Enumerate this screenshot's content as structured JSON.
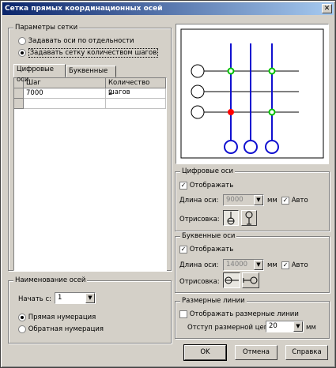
{
  "window": {
    "title": "Сетка прямых координационных осей",
    "close_glyph": "✕"
  },
  "grid_params": {
    "title": "Параметры сетки",
    "options": [
      {
        "label": "Задавать оси по отдельности",
        "selected": false
      },
      {
        "label": "Задавать сетку количеством шагов",
        "selected": true
      }
    ],
    "tabs": [
      {
        "label": "Цифровые оси",
        "active": true
      },
      {
        "label": "Буквенные оси",
        "active": false
      }
    ],
    "table": {
      "headers": [
        "Шаг",
        "Количество шагов"
      ],
      "rows": [
        [
          "7000",
          "2"
        ]
      ]
    }
  },
  "naming": {
    "title": "Наименование осей",
    "start_label": "Начать с:",
    "start_value": "1",
    "options": [
      {
        "label": "Прямая нумерация",
        "selected": true
      },
      {
        "label": "Обратная нумерация",
        "selected": false
      }
    ]
  },
  "digital_axes": {
    "title": "Цифровые оси",
    "show_label": "Отображать",
    "show_checked": true,
    "length_label": "Длина оси:",
    "length_value": "9000",
    "unit": "мм",
    "auto_label": "Авто",
    "auto_checked": true,
    "draw_label": "Отрисовка:"
  },
  "letter_axes": {
    "title": "Буквенные оси",
    "show_label": "Отображать",
    "show_checked": true,
    "length_label": "Длина оси:",
    "length_value": "14000",
    "unit": "мм",
    "auto_label": "Авто",
    "auto_checked": true,
    "draw_label": "Отрисовка:"
  },
  "dim_lines": {
    "title": "Размерные линии",
    "show_label": "Отображать размерные линии",
    "show_checked": false,
    "offset_label": "Отступ размерной цепи",
    "offset_value": "20",
    "unit": "мм"
  },
  "buttons": {
    "ok": "OK",
    "cancel": "Отмена",
    "help": "Справка"
  },
  "colors": {
    "title_start": "#0a246a",
    "axis_blue": "#1010d0",
    "node_green": "#00c000",
    "node_red": "#ff0000"
  }
}
